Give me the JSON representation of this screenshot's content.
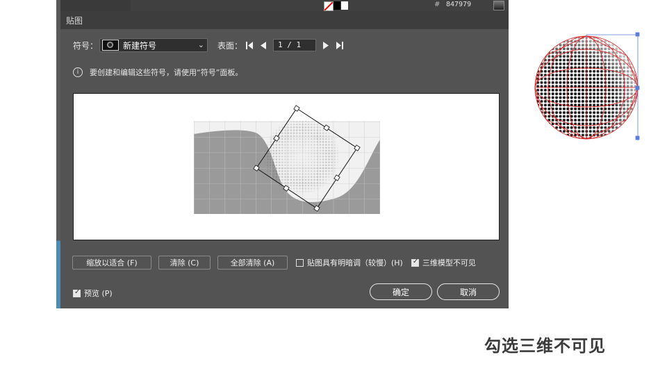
{
  "toolbar": {
    "hex_label": "#",
    "hex_value": "847979"
  },
  "dialog": {
    "title": "贴图",
    "symbol_label": "符号：",
    "symbol_value": "新建符号",
    "surface_label": "表面：",
    "page_value": "1 / 1",
    "info_text": "要创建和编辑这些符号，请使用“符号”面板。",
    "buttons": {
      "fit": "缩放以适合 (F)",
      "clear": "清除 (C)",
      "clear_all": "全部清除 (A)",
      "ok": "确定",
      "cancel": "取消"
    },
    "checkboxes": {
      "shade_label": "贴图具有明暗调（较慢）(H)",
      "shade_checked": false,
      "invisible_label": "三维模型不可见",
      "invisible_checked": true,
      "preview_label": "预览 (P)",
      "preview_checked": true
    }
  },
  "caption": "勾选三维不可见",
  "colors": {
    "dialog_bg": "#535353",
    "wireframe": "#e02020",
    "selection_handle": "#5b7fd6"
  }
}
